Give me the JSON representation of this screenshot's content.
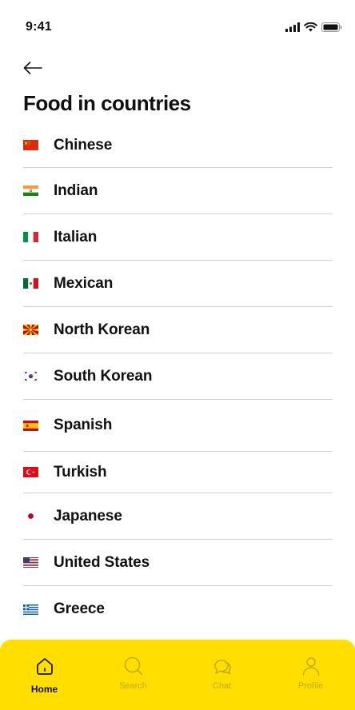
{
  "status_bar": {
    "time": "9:41"
  },
  "header": {
    "title": "Food in countries"
  },
  "countries": [
    {
      "name": "Chinese",
      "flag": "china-flag-icon"
    },
    {
      "name": "Indian",
      "flag": "india-flag-icon"
    },
    {
      "name": "Italian",
      "flag": "italy-flag-icon"
    },
    {
      "name": "Mexican",
      "flag": "mexico-flag-icon"
    },
    {
      "name": "North Korean",
      "flag": "north-macedonia-flag-icon"
    },
    {
      "name": "South Korean",
      "flag": "south-korea-flag-icon"
    },
    {
      "name": "Spanish",
      "flag": "spain-flag-icon"
    },
    {
      "name": "Turkish",
      "flag": "turkey-flag-icon"
    },
    {
      "name": "Japanese",
      "flag": "japan-flag-icon"
    },
    {
      "name": "United States",
      "flag": "usa-flag-icon"
    },
    {
      "name": "Greece",
      "flag": "greece-flag-icon"
    }
  ],
  "tab_bar": {
    "tabs": [
      {
        "label": "Home",
        "icon": "home-icon",
        "active": true
      },
      {
        "label": "Search",
        "icon": "search-icon",
        "active": false
      },
      {
        "label": "Chat",
        "icon": "chat-icon",
        "active": false
      },
      {
        "label": "Profile",
        "icon": "profile-icon",
        "active": false
      }
    ]
  },
  "colors": {
    "accent": "#FFDE00",
    "inactive_tab": "#C3A900",
    "text": "#111111",
    "divider": "#CFCFCF"
  }
}
